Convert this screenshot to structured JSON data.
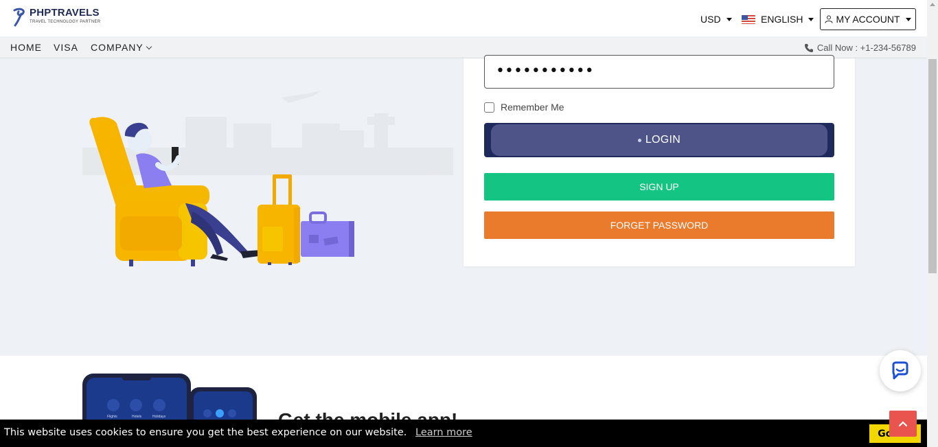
{
  "header": {
    "logo_title": "PHPTRAVELS",
    "logo_subtitle": "TRAVEL TECHNOLOGY PARTNER",
    "currency": "USD",
    "language": "ENGLISH",
    "account": "MY ACCOUNT"
  },
  "nav": {
    "items": [
      {
        "label": "HOME"
      },
      {
        "label": "VISA"
      },
      {
        "label": "COMPANY"
      }
    ],
    "call_now": "Call Now : +1-234-56789"
  },
  "login_form": {
    "password_value": "•••••••••••",
    "remember_label": "Remember Me",
    "login_label": "LOGIN",
    "signup_label": "SIGN UP",
    "forget_label": "FORGET PASSWORD"
  },
  "app_section": {
    "heading": "Get the mobile app!"
  },
  "cookie_bar": {
    "message": "This website uses cookies to ensure you get the best experience on our website.",
    "link": "Learn more",
    "button": "Got it!"
  },
  "colors": {
    "login": "#1f2a5c",
    "signup": "#14c482",
    "forget": "#ea7a2c",
    "cookie_button": "#f1d600",
    "back_to_top": "#e9544f"
  }
}
